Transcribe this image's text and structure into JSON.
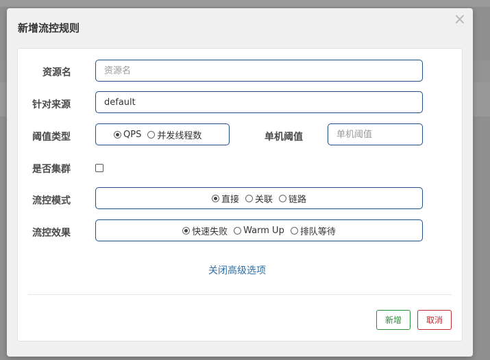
{
  "dialog": {
    "title": "新增流控规则",
    "close_glyph": "×"
  },
  "form": {
    "resource": {
      "label": "资源名",
      "value": "",
      "placeholder": "资源名"
    },
    "limit_app": {
      "label": "针对来源",
      "value": "default"
    },
    "threshold_type": {
      "label": "阈值类型",
      "options": [
        {
          "label": "QPS",
          "checked": true
        },
        {
          "label": "并发线程数",
          "checked": false
        }
      ]
    },
    "single_threshold": {
      "label": "单机阈值",
      "value": "",
      "placeholder": "单机阈值"
    },
    "cluster": {
      "label": "是否集群",
      "checked": false
    },
    "flow_mode": {
      "label": "流控模式",
      "options": [
        {
          "label": "直接",
          "checked": true
        },
        {
          "label": "关联",
          "checked": false
        },
        {
          "label": "链路",
          "checked": false
        }
      ]
    },
    "control_behavior": {
      "label": "流控效果",
      "options": [
        {
          "label": "快速失败",
          "checked": true
        },
        {
          "label": "Warm Up",
          "checked": false
        },
        {
          "label": "排队等待",
          "checked": false
        }
      ]
    },
    "advanced_link": "关闭高级选项"
  },
  "footer": {
    "add_label": "新增",
    "cancel_label": "取消"
  }
}
